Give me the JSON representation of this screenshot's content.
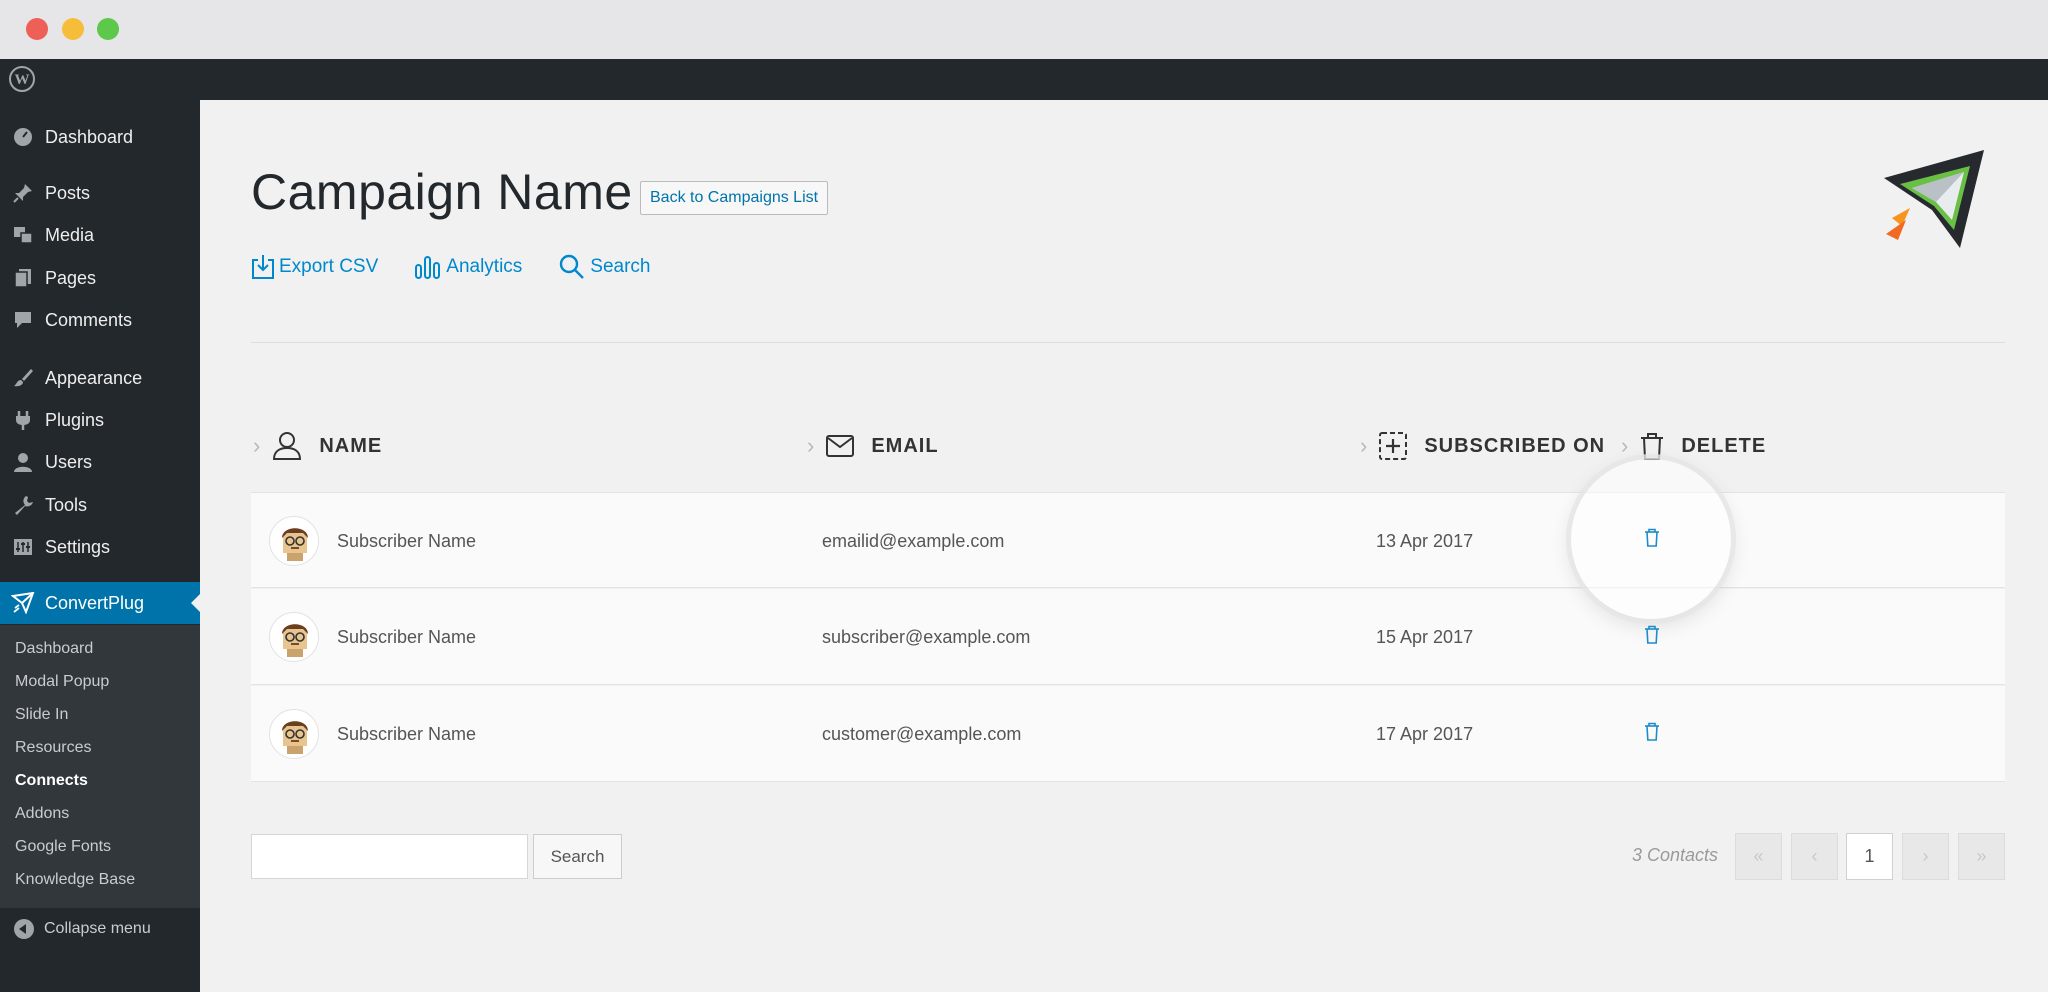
{
  "window": {
    "controls": [
      "close",
      "minimize",
      "maximize"
    ]
  },
  "sidebar": {
    "items": [
      {
        "label": "Dashboard",
        "icon": "dashboard-icon"
      },
      {
        "label": "Posts",
        "icon": "pin-icon"
      },
      {
        "label": "Media",
        "icon": "media-icon"
      },
      {
        "label": "Pages",
        "icon": "pages-icon"
      },
      {
        "label": "Comments",
        "icon": "comment-icon"
      },
      {
        "label": "Appearance",
        "icon": "brush-icon"
      },
      {
        "label": "Plugins",
        "icon": "plug-icon"
      },
      {
        "label": "Users",
        "icon": "user-icon"
      },
      {
        "label": "Tools",
        "icon": "wrench-icon"
      },
      {
        "label": "Settings",
        "icon": "settings-icon"
      },
      {
        "label": "ConvertPlug",
        "icon": "convertplug-icon",
        "active": true
      }
    ],
    "submenu": [
      "Dashboard",
      "Modal Popup",
      "Slide In",
      "Resources",
      "Connects",
      "Addons",
      "Google Fonts",
      "Knowledge Base"
    ],
    "submenu_current": "Connects",
    "collapse_label": "Collapse menu"
  },
  "header": {
    "title": "Campaign Name",
    "back_button": "Back to Campaigns List"
  },
  "actions": {
    "export": "Export CSV",
    "analytics": "Analytics",
    "search": "Search"
  },
  "table": {
    "columns": [
      "NAME",
      "EMAIL",
      "SUBSCRIBED ON",
      "DELETE"
    ],
    "rows": [
      {
        "name": "Subscriber Name",
        "email": "emailid@example.com",
        "date": "13 Apr 2017"
      },
      {
        "name": "Subscriber Name",
        "email": "subscriber@example.com",
        "date": "15 Apr 2017"
      },
      {
        "name": "Subscriber Name",
        "email": "customer@example.com",
        "date": "17 Apr 2017"
      }
    ]
  },
  "footer": {
    "search_button": "Search",
    "search_value": "",
    "contacts_count": "3 Contacts",
    "pagination": {
      "first": "«",
      "prev": "‹",
      "current": "1",
      "next": "›",
      "last": "»"
    }
  },
  "colors": {
    "accent": "#0073aa",
    "link": "#0088cc",
    "sidebar_bg": "#23282d"
  }
}
